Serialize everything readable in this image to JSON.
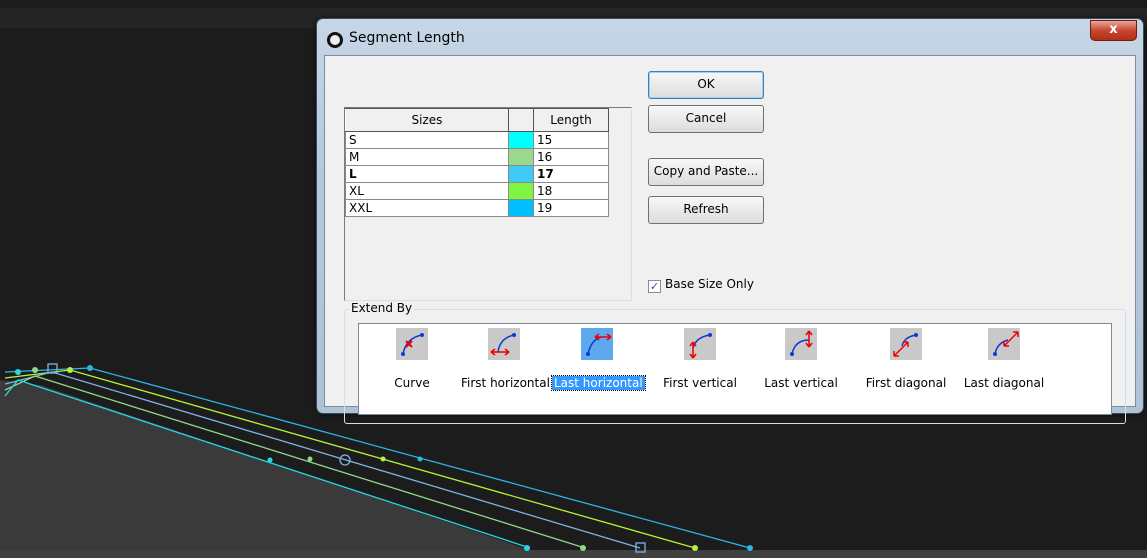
{
  "dialog": {
    "title": "Segment Length",
    "close_label": "x"
  },
  "grid": {
    "headers": [
      "Sizes",
      "",
      "Length"
    ],
    "rows": [
      {
        "size": "S",
        "color": "#00ffff",
        "length": "15",
        "selected": false
      },
      {
        "size": "M",
        "color": "#98d98e",
        "length": "16",
        "selected": false
      },
      {
        "size": "L",
        "color": "#3fc9f7",
        "length": "17",
        "selected": true
      },
      {
        "size": "XL",
        "color": "#7ef542",
        "length": "18",
        "selected": false
      },
      {
        "size": "XXL",
        "color": "#00bfff",
        "length": "19",
        "selected": false
      }
    ]
  },
  "buttons": {
    "ok": "OK",
    "cancel": "Cancel",
    "copy_paste": "Copy and Paste...",
    "refresh": "Refresh"
  },
  "base_size_only": {
    "label": "Base Size Only",
    "checked": true
  },
  "extend_by": {
    "label": "Extend By",
    "options": [
      {
        "label": "Curve",
        "icon": "curve-icon",
        "selected": false
      },
      {
        "label": "First horizontal",
        "icon": "first-horizontal-icon",
        "selected": false
      },
      {
        "label": "Last horizontal",
        "icon": "last-horizontal-icon",
        "selected": true
      },
      {
        "label": "First vertical",
        "icon": "first-vertical-icon",
        "selected": false
      },
      {
        "label": "Last vertical",
        "icon": "last-vertical-icon",
        "selected": false
      },
      {
        "label": "First diagonal",
        "icon": "first-diagonal-icon",
        "selected": false
      },
      {
        "label": "Last diagonal",
        "icon": "last-diagonal-icon",
        "selected": false
      }
    ]
  }
}
